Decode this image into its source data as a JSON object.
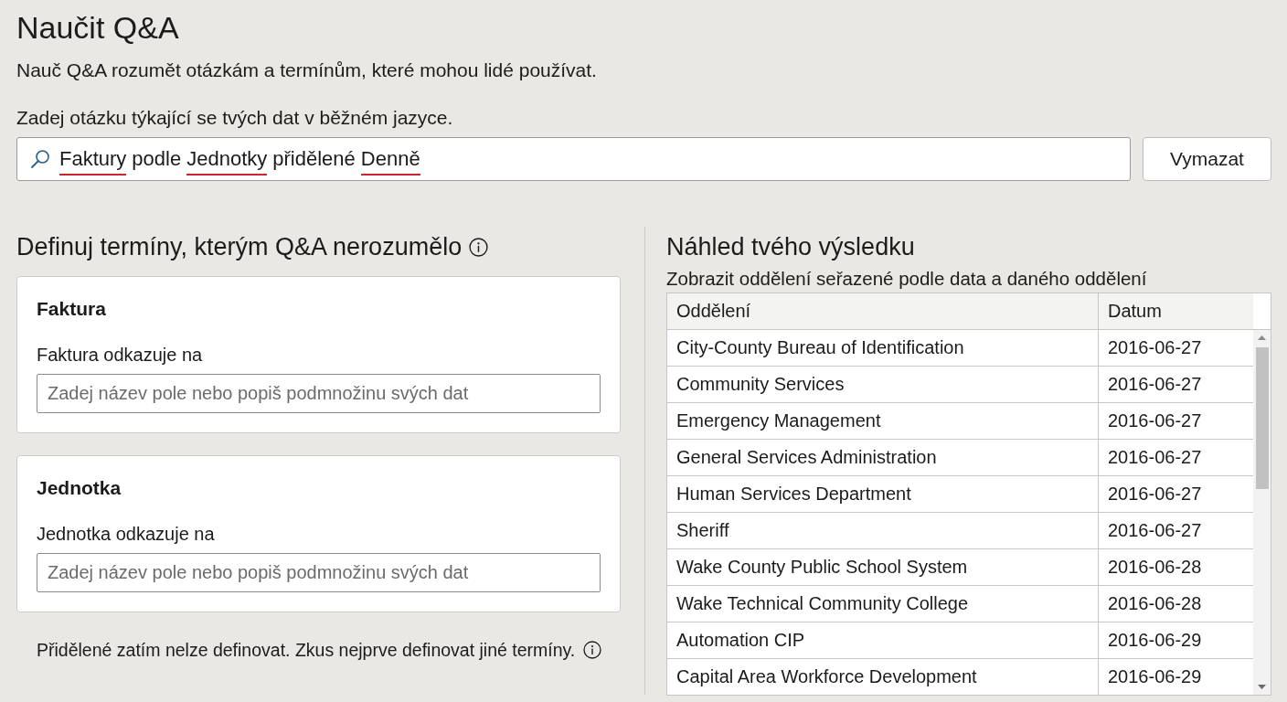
{
  "header": {
    "title": "Naučit Q&A",
    "subtitle": "Nauč Q&A rozumět otázkám a termínům, které mohou lidé používat."
  },
  "query": {
    "label": "Zadej otázku týkající se tvých dat v běžném jazyce.",
    "terms": [
      {
        "text": "Faktury",
        "unrecognized": true
      },
      {
        "text": "podle",
        "unrecognized": false
      },
      {
        "text": "Jednotky",
        "unrecognized": true
      },
      {
        "text": "přidělené",
        "unrecognized": false
      },
      {
        "text": "Denně",
        "unrecognized": true
      }
    ],
    "clear_button": "Vymazat"
  },
  "definitions": {
    "heading": "Definuj termíny, kterým Q&A nerozumělo",
    "cards": [
      {
        "term": "Faktura",
        "field_label": "Faktura odkazuje na",
        "placeholder": "Zadej název pole nebo popiš podmnožinu svých dat"
      },
      {
        "term": "Jednotka",
        "field_label": "Jednotka odkazuje na",
        "placeholder": "Zadej název pole nebo popiš podmnožinu svých dat"
      }
    ],
    "note": "Přidělené zatím nelze definovat. Zkus nejprve definovat jiné termíny."
  },
  "preview": {
    "heading": "Náhled tvého výsledku",
    "description": "Zobrazit oddělení seřazené podle data a daného oddělení",
    "table": {
      "columns": [
        "Oddělení",
        "Datum"
      ],
      "rows": [
        [
          "City-County Bureau of Identification",
          "2016-06-27"
        ],
        [
          "Community Services",
          "2016-06-27"
        ],
        [
          "Emergency Management",
          "2016-06-27"
        ],
        [
          "General Services Administration",
          "2016-06-27"
        ],
        [
          "Human Services Department",
          "2016-06-27"
        ],
        [
          "Sheriff",
          "2016-06-27"
        ],
        [
          "Wake County Public School System",
          "2016-06-28"
        ],
        [
          "Wake Technical Community College",
          "2016-06-28"
        ],
        [
          "Automation CIP",
          "2016-06-29"
        ],
        [
          "Capital Area Workforce Development",
          "2016-06-29"
        ]
      ]
    }
  }
}
